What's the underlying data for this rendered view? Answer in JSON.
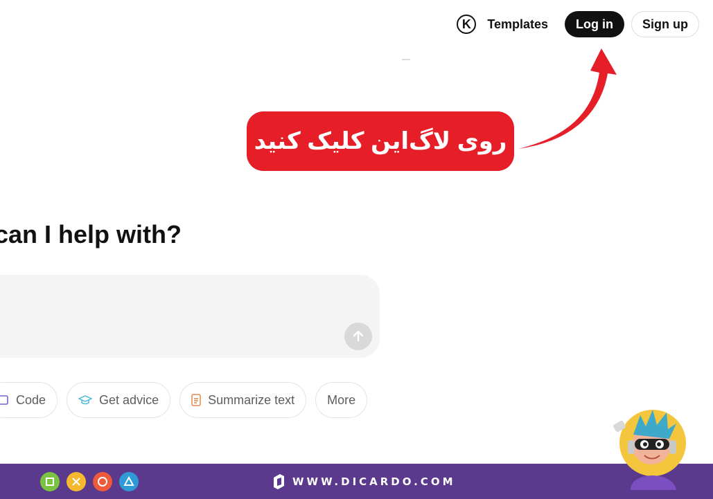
{
  "header": {
    "logo_letter": "K",
    "templates_label": "Templates",
    "login_label": "Log in",
    "signup_label": "Sign up"
  },
  "callout": {
    "text": "روی لاگ‌این کلیک کنید",
    "color": "#e61e28"
  },
  "main": {
    "heading": "can I help with?",
    "prompt_placeholder": "",
    "send_icon": "arrow-up-icon"
  },
  "chips": [
    {
      "label": "Code",
      "icon": "code-icon"
    },
    {
      "label": "Get advice",
      "icon": "graduation-cap-icon"
    },
    {
      "label": "Summarize text",
      "icon": "document-icon"
    },
    {
      "label": "More",
      "icon": ""
    }
  ],
  "footer": {
    "brand": "WWW.DICARDO.COM",
    "bar_color": "#5b3a8e",
    "game_icons": [
      "square-icon",
      "cross-icon",
      "circle-icon",
      "triangle-icon"
    ]
  }
}
